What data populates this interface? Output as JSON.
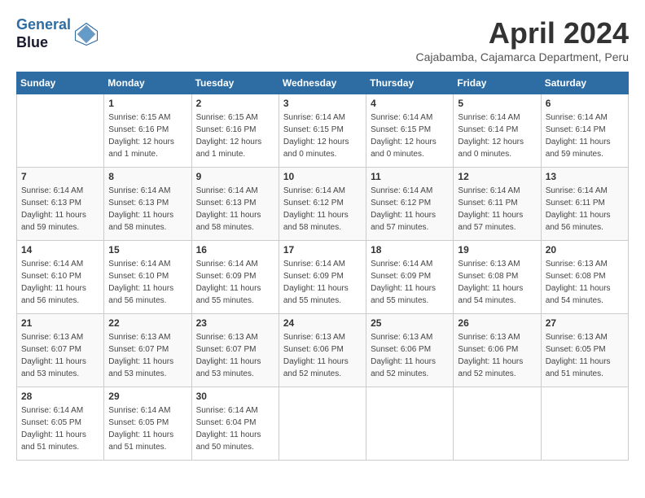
{
  "header": {
    "logo_line1": "General",
    "logo_line2": "Blue",
    "month_title": "April 2024",
    "subtitle": "Cajabamba, Cajamarca Department, Peru"
  },
  "weekdays": [
    "Sunday",
    "Monday",
    "Tuesday",
    "Wednesday",
    "Thursday",
    "Friday",
    "Saturday"
  ],
  "weeks": [
    [
      {
        "day": "",
        "info": ""
      },
      {
        "day": "1",
        "info": "Sunrise: 6:15 AM\nSunset: 6:16 PM\nDaylight: 12 hours\nand 1 minute."
      },
      {
        "day": "2",
        "info": "Sunrise: 6:15 AM\nSunset: 6:16 PM\nDaylight: 12 hours\nand 1 minute."
      },
      {
        "day": "3",
        "info": "Sunrise: 6:14 AM\nSunset: 6:15 PM\nDaylight: 12 hours\nand 0 minutes."
      },
      {
        "day": "4",
        "info": "Sunrise: 6:14 AM\nSunset: 6:15 PM\nDaylight: 12 hours\nand 0 minutes."
      },
      {
        "day": "5",
        "info": "Sunrise: 6:14 AM\nSunset: 6:14 PM\nDaylight: 12 hours\nand 0 minutes."
      },
      {
        "day": "6",
        "info": "Sunrise: 6:14 AM\nSunset: 6:14 PM\nDaylight: 11 hours\nand 59 minutes."
      }
    ],
    [
      {
        "day": "7",
        "info": "Sunrise: 6:14 AM\nSunset: 6:13 PM\nDaylight: 11 hours\nand 59 minutes."
      },
      {
        "day": "8",
        "info": "Sunrise: 6:14 AM\nSunset: 6:13 PM\nDaylight: 11 hours\nand 58 minutes."
      },
      {
        "day": "9",
        "info": "Sunrise: 6:14 AM\nSunset: 6:13 PM\nDaylight: 11 hours\nand 58 minutes."
      },
      {
        "day": "10",
        "info": "Sunrise: 6:14 AM\nSunset: 6:12 PM\nDaylight: 11 hours\nand 58 minutes."
      },
      {
        "day": "11",
        "info": "Sunrise: 6:14 AM\nSunset: 6:12 PM\nDaylight: 11 hours\nand 57 minutes."
      },
      {
        "day": "12",
        "info": "Sunrise: 6:14 AM\nSunset: 6:11 PM\nDaylight: 11 hours\nand 57 minutes."
      },
      {
        "day": "13",
        "info": "Sunrise: 6:14 AM\nSunset: 6:11 PM\nDaylight: 11 hours\nand 56 minutes."
      }
    ],
    [
      {
        "day": "14",
        "info": "Sunrise: 6:14 AM\nSunset: 6:10 PM\nDaylight: 11 hours\nand 56 minutes."
      },
      {
        "day": "15",
        "info": "Sunrise: 6:14 AM\nSunset: 6:10 PM\nDaylight: 11 hours\nand 56 minutes."
      },
      {
        "day": "16",
        "info": "Sunrise: 6:14 AM\nSunset: 6:09 PM\nDaylight: 11 hours\nand 55 minutes."
      },
      {
        "day": "17",
        "info": "Sunrise: 6:14 AM\nSunset: 6:09 PM\nDaylight: 11 hours\nand 55 minutes."
      },
      {
        "day": "18",
        "info": "Sunrise: 6:14 AM\nSunset: 6:09 PM\nDaylight: 11 hours\nand 55 minutes."
      },
      {
        "day": "19",
        "info": "Sunrise: 6:13 AM\nSunset: 6:08 PM\nDaylight: 11 hours\nand 54 minutes."
      },
      {
        "day": "20",
        "info": "Sunrise: 6:13 AM\nSunset: 6:08 PM\nDaylight: 11 hours\nand 54 minutes."
      }
    ],
    [
      {
        "day": "21",
        "info": "Sunrise: 6:13 AM\nSunset: 6:07 PM\nDaylight: 11 hours\nand 53 minutes."
      },
      {
        "day": "22",
        "info": "Sunrise: 6:13 AM\nSunset: 6:07 PM\nDaylight: 11 hours\nand 53 minutes."
      },
      {
        "day": "23",
        "info": "Sunrise: 6:13 AM\nSunset: 6:07 PM\nDaylight: 11 hours\nand 53 minutes."
      },
      {
        "day": "24",
        "info": "Sunrise: 6:13 AM\nSunset: 6:06 PM\nDaylight: 11 hours\nand 52 minutes."
      },
      {
        "day": "25",
        "info": "Sunrise: 6:13 AM\nSunset: 6:06 PM\nDaylight: 11 hours\nand 52 minutes."
      },
      {
        "day": "26",
        "info": "Sunrise: 6:13 AM\nSunset: 6:06 PM\nDaylight: 11 hours\nand 52 minutes."
      },
      {
        "day": "27",
        "info": "Sunrise: 6:13 AM\nSunset: 6:05 PM\nDaylight: 11 hours\nand 51 minutes."
      }
    ],
    [
      {
        "day": "28",
        "info": "Sunrise: 6:14 AM\nSunset: 6:05 PM\nDaylight: 11 hours\nand 51 minutes."
      },
      {
        "day": "29",
        "info": "Sunrise: 6:14 AM\nSunset: 6:05 PM\nDaylight: 11 hours\nand 51 minutes."
      },
      {
        "day": "30",
        "info": "Sunrise: 6:14 AM\nSunset: 6:04 PM\nDaylight: 11 hours\nand 50 minutes."
      },
      {
        "day": "",
        "info": ""
      },
      {
        "day": "",
        "info": ""
      },
      {
        "day": "",
        "info": ""
      },
      {
        "day": "",
        "info": ""
      }
    ]
  ]
}
